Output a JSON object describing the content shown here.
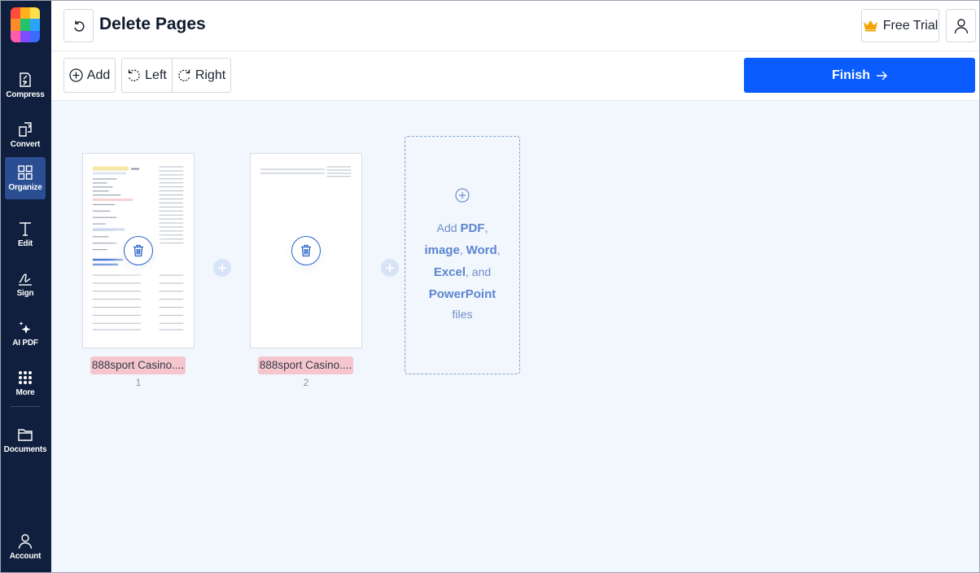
{
  "sidebar": {
    "logo_colors": [
      "#ff4f3a",
      "#ffb21c",
      "#ffe24a",
      "#22c36b",
      "#2aa4ff",
      "#ff5cab",
      "#3b6bff",
      "#7d4dff",
      "#b64dff"
    ],
    "items": [
      {
        "label": "Compress",
        "icon": "compress-icon"
      },
      {
        "label": "Convert",
        "icon": "convert-icon"
      },
      {
        "label": "Organize",
        "icon": "organize-icon",
        "active": true
      },
      {
        "label": "Edit",
        "icon": "edit-text-icon"
      },
      {
        "label": "Sign",
        "icon": "signature-icon"
      },
      {
        "label": "AI PDF",
        "icon": "sparkle-icon"
      },
      {
        "label": "More",
        "icon": "grid-dots-icon"
      },
      {
        "label": "Documents",
        "icon": "folder-icon"
      },
      {
        "label": "Account",
        "icon": "user-icon"
      }
    ]
  },
  "header": {
    "title": "Delete Pages",
    "trial_label": "Free Trial"
  },
  "toolbar": {
    "add_label": "Add",
    "left_label": "Left",
    "right_label": "Right",
    "finish_label": "Finish"
  },
  "pages": [
    {
      "filename": "888sport Casino....",
      "number": "1"
    },
    {
      "filename": "888sport Casino....",
      "number": "2"
    }
  ],
  "add_zone": {
    "t1": "Add ",
    "pdf": "PDF",
    "c1": ",",
    "image": "image",
    "c2": ", ",
    "word": "Word",
    "c3": ",",
    "excel": "Excel",
    "and": ", and",
    "powerpoint": "PowerPoint",
    "files": "files"
  },
  "colors": {
    "sidebar_bg": "#0f1f3d",
    "sidebar_active": "#2b4e92",
    "accent": "#0a5cff",
    "page_bg": "#f2f6fd",
    "filename_pill": "#f6c6cf"
  }
}
